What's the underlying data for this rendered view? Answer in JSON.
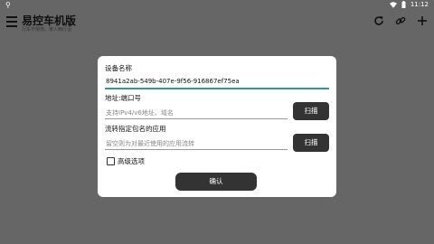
{
  "status_bar": {
    "time": "11:12",
    "left_icon": "usb-icon"
  },
  "app": {
    "title": "易控车机版",
    "subtitle": "行车不规范，家人两行泪"
  },
  "dialog": {
    "device_name_label": "设备名称",
    "device_name_value": "8941a2ab-549b-407e-9f56-916867ef75ea",
    "address_label": "地址:端口号",
    "address_placeholder": "支持IPv4/v6地址、域名",
    "scan_label": "扫描",
    "package_label": "流转指定包名的应用",
    "package_placeholder": "留空则为对最近使用的应用流转",
    "advanced_label": "高级选项",
    "confirm_label": "确认"
  },
  "colors": {
    "accent": "#2a9d8f",
    "button": "#333333",
    "background_dim": "#666666"
  }
}
